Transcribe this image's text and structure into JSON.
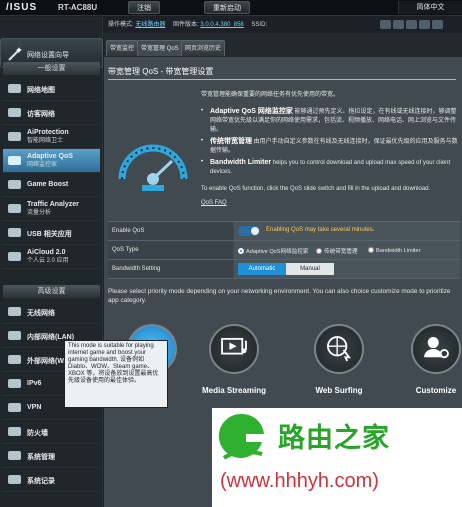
{
  "header": {
    "brand": "/ISUS",
    "model": "RT-AC88U",
    "logout": "注销",
    "reboot": "重新启动",
    "language": "简体中文"
  },
  "infobar": {
    "mode_label": "操作模式:",
    "mode_value": "无线路由器",
    "firmware_label": "固件版本:",
    "firmware_value": "3.0.0.4.380_858",
    "ssid_label": "SSID:"
  },
  "sidebar": {
    "quick_setup": "网络设置向导",
    "general_header": "一般设置",
    "general_items": [
      {
        "icon": "network-map-icon",
        "t1": "网络地图",
        "t2": ""
      },
      {
        "icon": "guest-network-icon",
        "t1": "访客网络",
        "t2": ""
      },
      {
        "icon": "aiprotection-icon",
        "t1": "AiProtection",
        "t2": "智能网络卫士"
      },
      {
        "icon": "adaptive-qos-icon",
        "t1": "Adaptive QoS",
        "t2": "网络监控家"
      },
      {
        "icon": "game-boost-icon",
        "t1": "Game Boost",
        "t2": ""
      },
      {
        "icon": "traffic-analyzer-icon",
        "t1": "Traffic Analyzer",
        "t2": "流量分析"
      },
      {
        "icon": "usb-icon",
        "t1": "USB 相关应用",
        "t2": ""
      },
      {
        "icon": "aicloud-icon",
        "t1": "AiCloud 2.0",
        "t2": "个人云 2.0 应用"
      }
    ],
    "advanced_header": "高级设置",
    "advanced_items": [
      {
        "icon": "wireless-icon",
        "label": "无线网络"
      },
      {
        "icon": "lan-icon",
        "label": "内部网络(LAN)"
      },
      {
        "icon": "wan-icon",
        "label": "外部网络(WAN)"
      },
      {
        "icon": "ipv6-icon",
        "label": "IPv6"
      },
      {
        "icon": "vpn-icon",
        "label": "VPN"
      },
      {
        "icon": "firewall-icon",
        "label": "防火墙"
      },
      {
        "icon": "admin-icon",
        "label": "系统管理"
      },
      {
        "icon": "log-icon",
        "label": "系统记录"
      }
    ]
  },
  "tabs": [
    "带宽监控",
    "带宽管理 QoS",
    "网页浏览历史"
  ],
  "main": {
    "title": "带宽管理 QoS - 带宽管理设置",
    "intro": "带宽管理能确保重要的网络任务有优先使用的带宽。",
    "bullets": [
      {
        "b": "Adaptive QoS 网络监控家",
        "t": "能够通过预先定义、拖拉设定，在有线或无线连接时，够调整网络带宽优先级以满足你的网络使用需求，包括流、视频播放、网络电话、网上浏览与文件传输。"
      },
      {
        "b": "传统带宽管理",
        "t": "由用户手动自定义参数在有线及无线连接时，保证最优先级的应用及服务与数据传输。"
      },
      {
        "b": "Bandwidth Limiter",
        "t": "helps you to control download and upload max speed of your client devices."
      }
    ],
    "enable_note": "To enable QoS function, click the QoS slide switch and fill in the upload and download.",
    "faq": "QoS FAQ",
    "rows": {
      "enable_label": "Enable QoS",
      "enable_note": "Enabling QoS may take several minutes.",
      "type_label": "QoS Type",
      "type_options": [
        "Adaptive QoS网络监控家",
        "传统带宽管理",
        "Bandwidth Limiter"
      ],
      "bw_label": "Bandwidth Setting",
      "bw_options": [
        "Automatic",
        "Manual"
      ]
    },
    "select_text": "Please select priority mode depending on your networking environment. You can also choice customize mode to prioritize app category.",
    "modes": [
      {
        "icon": "game-controller-icon",
        "label": ""
      },
      {
        "icon": "media-streaming-icon",
        "label": "Media Streaming"
      },
      {
        "icon": "web-surfing-icon",
        "label": "Web Surfing"
      },
      {
        "icon": "customize-icon",
        "label": "Customize"
      }
    ],
    "tooltip": "This mode is suitable for playing internet game and boost your gaming bandwidth. 设备例如 Diablo、WOW、Steam game、XBOX 等，将设备放到设置最高优先级设备使用的最佳体验。"
  },
  "watermark": {
    "cn": "路由之家",
    "url": "(www.hhhyh.com)"
  },
  "colors": {
    "accent": "#1f8fd6",
    "warning": "#ffc65a",
    "watermark_green": "#28a428",
    "watermark_red": "#d5303a"
  }
}
